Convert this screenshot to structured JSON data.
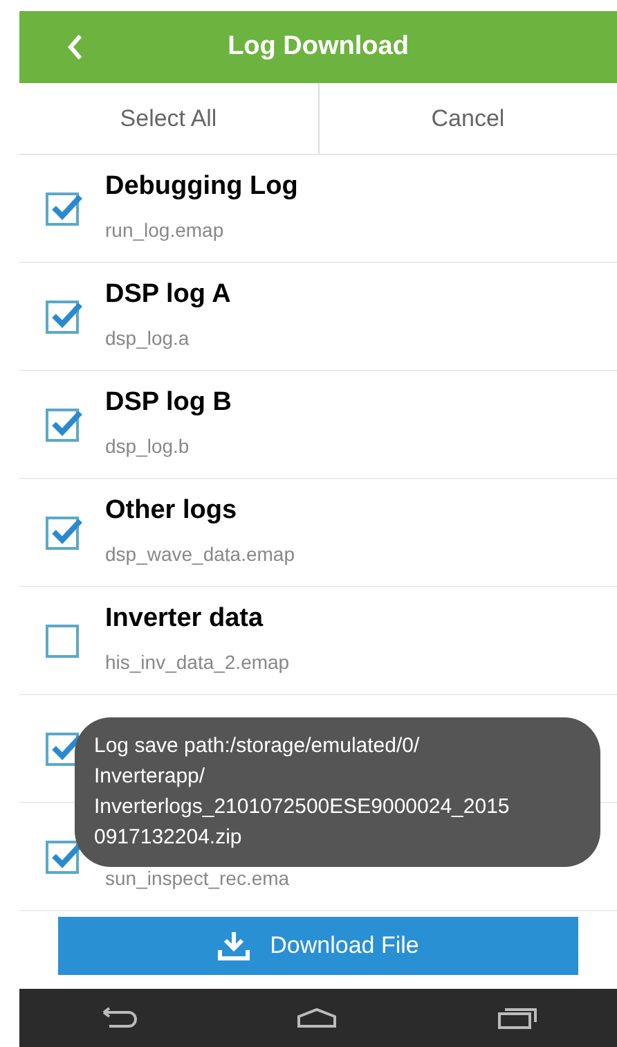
{
  "header": {
    "title": "Log Download"
  },
  "actions": [
    "Select All",
    "Cancel"
  ],
  "items": [
    {
      "title": "Debugging Log",
      "file": "run_log.emap",
      "checked": true
    },
    {
      "title": "DSP log A",
      "file": "dsp_log.a",
      "checked": true
    },
    {
      "title": "DSP log B",
      "file": "dsp_log.b",
      "checked": true
    },
    {
      "title": "Other logs",
      "file": "dsp_wave_data.emap",
      "checked": true
    },
    {
      "title": "Inverter data",
      "file": "his_inv_data_2.emap",
      "checked": false
    },
    {
      "checked": true
    },
    {
      "file": "sun_inspect_rec.ema",
      "checked": true
    }
  ],
  "toast": {
    "text": "Log save path:/storage/emulated/0/\nInverterapp/\nInverterlogs_2101072500ESE9000024_2015\n0917132204.zip"
  },
  "download_button": {
    "label": "Download File"
  }
}
